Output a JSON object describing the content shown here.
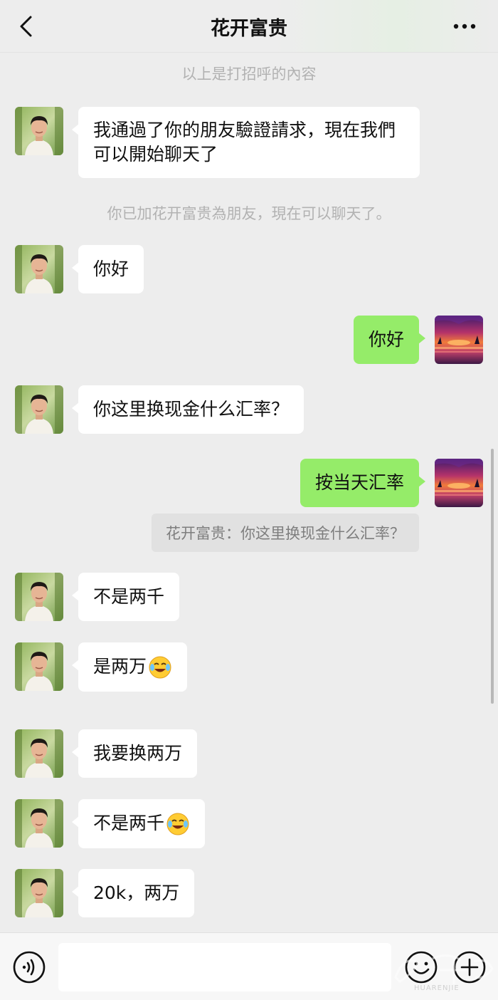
{
  "header": {
    "title": "花开富贵",
    "back_icon": "chevron-left-icon",
    "more_icon": "more-dots-icon"
  },
  "system_messages": {
    "greeting_note": "以上是打招呼的內容",
    "friend_added": "你已加花开富贵為朋友，現在可以聊天了。"
  },
  "messages": [
    {
      "from": "contact",
      "text": "我通過了你的朋友驗證請求，現在我們可以開始聊天了"
    },
    {
      "from": "contact",
      "text": "你好"
    },
    {
      "from": "me",
      "text": "你好"
    },
    {
      "from": "contact",
      "text": "你这里换现金什么汇率？"
    },
    {
      "from": "me",
      "text": "按当天汇率",
      "quote": "花开富贵：你这里换现金什么汇率？"
    },
    {
      "from": "contact",
      "text": "不是两千"
    },
    {
      "from": "contact",
      "text": "是两万",
      "emoji": "laughing-crying-emoji"
    },
    {
      "from": "contact",
      "text": "我要换两万"
    },
    {
      "from": "contact",
      "text": "不是两千",
      "emoji": "laughing-crying-emoji"
    },
    {
      "from": "contact",
      "text": "20k，两万"
    }
  ],
  "input_bar": {
    "value": "",
    "voice_icon": "voice-icon",
    "emoji_icon": "smiley-icon",
    "plus_icon": "plus-icon"
  },
  "watermark": {
    "text": "HUARENJIE"
  },
  "colors": {
    "background": "#ededed",
    "incoming_bubble": "#ffffff",
    "outgoing_bubble": "#95ec69",
    "system_text": "#b2b2b2"
  }
}
